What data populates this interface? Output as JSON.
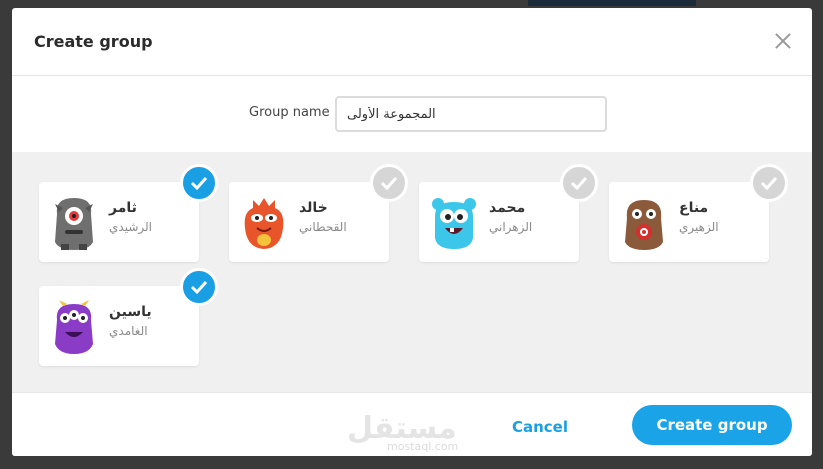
{
  "modal": {
    "title": "Create group",
    "close_icon": "close-icon"
  },
  "form": {
    "group_name_label": "Group name",
    "group_name_value": "المجموعة الأولى"
  },
  "members": [
    {
      "first": "ثامر",
      "last": "الرشيدي",
      "selected": true,
      "avatar_color": "#6f6f6f",
      "eye_color": "#e23b3b"
    },
    {
      "first": "خالد",
      "last": "القحطاني",
      "selected": false,
      "avatar_color": "#e8552b",
      "eye_color": "#ffffff"
    },
    {
      "first": "محمد",
      "last": "الزهراني",
      "selected": false,
      "avatar_color": "#3cc6ea",
      "eye_color": "#ffffff"
    },
    {
      "first": "مناع",
      "last": "الزهيري",
      "selected": false,
      "avatar_color": "#8a5a3b",
      "eye_color": "#ffffff"
    },
    {
      "first": "ياسين",
      "last": "الغامدي",
      "selected": true,
      "avatar_color": "#8a3cc7",
      "eye_color": "#ffffff"
    }
  ],
  "footer": {
    "cancel_label": "Cancel",
    "create_label": "Create group",
    "watermark_ar": "مستقل",
    "watermark_en": "mostaql.com"
  },
  "colors": {
    "accent": "#1a9fe4",
    "check_off": "#d6d6d6",
    "members_bg": "#f0f0f0"
  }
}
